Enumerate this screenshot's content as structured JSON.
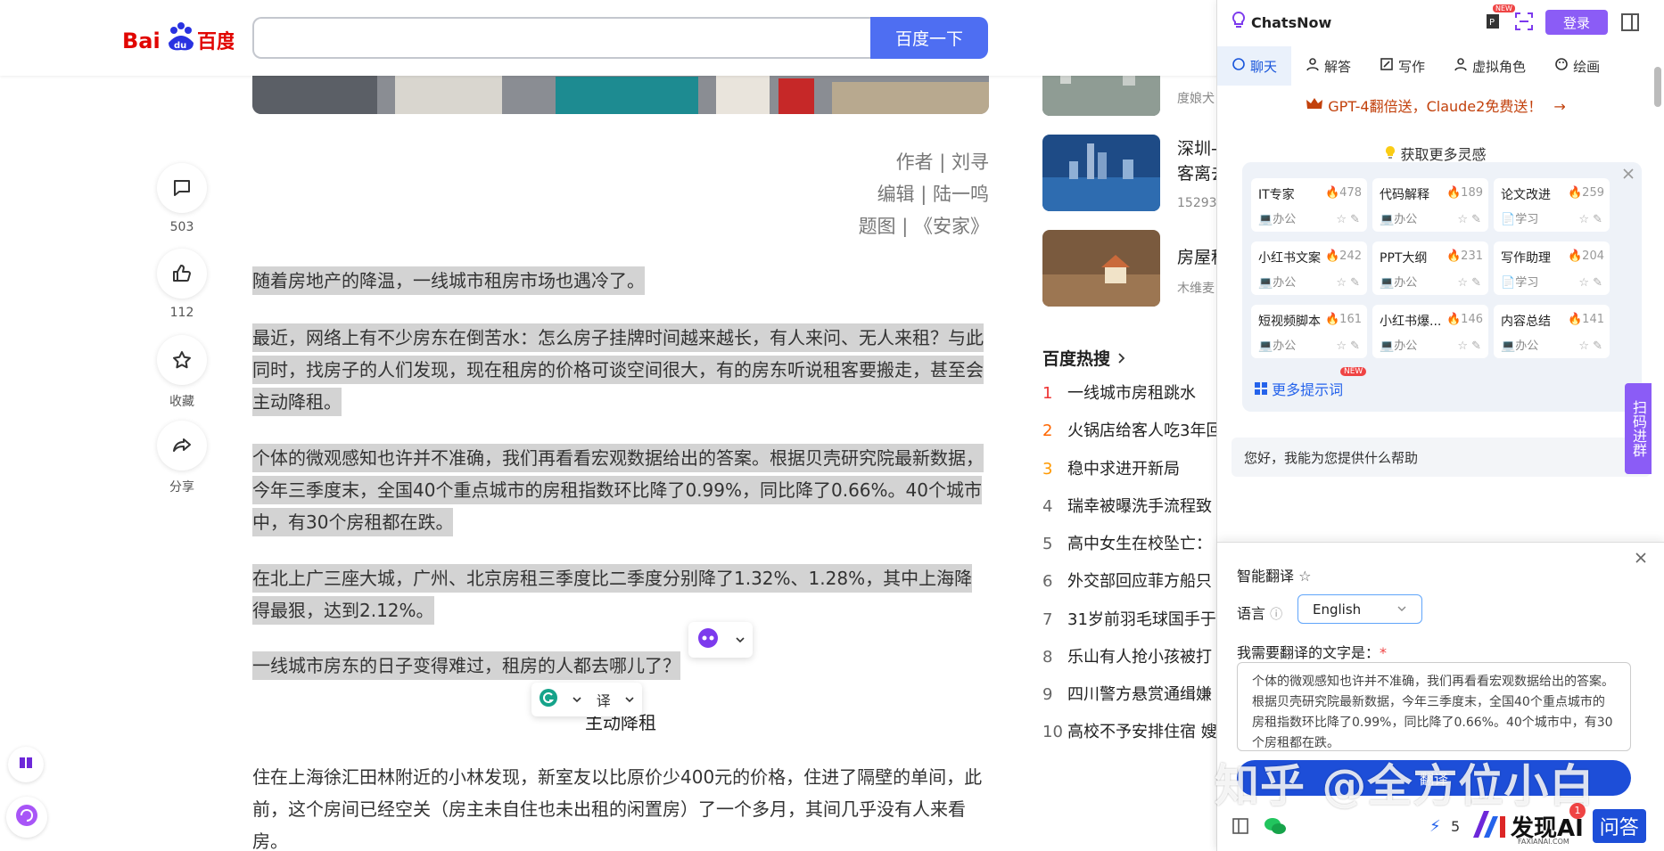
{
  "header": {
    "logo_text": "百度",
    "logo_prefix": "Bai",
    "logo_du": "du",
    "search_value": "",
    "search_button": "百度一下"
  },
  "actions": [
    {
      "name": "comment",
      "count": "503"
    },
    {
      "name": "like",
      "count": "112"
    },
    {
      "name": "collect",
      "count": "收藏"
    },
    {
      "name": "share",
      "count": "分享"
    }
  ],
  "article": {
    "credits": [
      "作者 | 刘寻",
      "编辑 | 陆一鸣",
      "题图 | 《安家》"
    ],
    "paragraphs": [
      "随着房地产的降温，一线城市租房市场也遇冷了。",
      "最近，网络上有不少房东在倒苦水：怎么房子挂牌时间越来越长，有人来问、无人来租？与此同时，找房子的人们发现，现在租房的价格可谈空间很大，有的房东听说租客要搬走，甚至会主动降租。",
      "个体的微观感知也许并不准确，我们再看看宏观数据给出的答案。根据贝壳研究院最新数据，今年三季度末，全国40个重点城市的房租指数环比降了0.99%，同比降了0.66%。40个城市中，有30个房租都在跌。",
      "在北上广三座大城，广州、北京房租三季度比二季度分别降了1.32%、1.28%，其中上海降得最狠，达到2.12%。",
      "一线城市房东的日子变得难过，租房的人都去哪儿了？"
    ],
    "subhead": "主动降租",
    "body": "住在上海徐汇田林附近的小林发现，新室友以比原价少400元的价格，住进了隔壁的单间，此前，这个房间已经空关（房主未自住也未出租的闲置房）了一个多月，其间几乎没有人来看房。"
  },
  "floating": {
    "translate_label": "译"
  },
  "news": [
    {
      "title": "",
      "meta": "度娘犬"
    },
    {
      "title": "深圳-客离去",
      "line2": "客离去",
      "meta": "15293"
    },
    {
      "title": "房屋租",
      "meta": "木维麦"
    }
  ],
  "hot": {
    "title": "百度热搜",
    "items": [
      {
        "rank": "1",
        "text": "一线城市房租跳水"
      },
      {
        "rank": "2",
        "text": "火锅店给客人吃3年回"
      },
      {
        "rank": "3",
        "text": "稳中求进开新局"
      },
      {
        "rank": "4",
        "text": "瑞幸被曝洗手流程致"
      },
      {
        "rank": "5",
        "text": "高中女生在校坠亡："
      },
      {
        "rank": "6",
        "text": "外交部回应菲方船只"
      },
      {
        "rank": "7",
        "text": "31岁前羽毛球国手于"
      },
      {
        "rank": "8",
        "text": "乐山有人抢小孩被打"
      },
      {
        "rank": "9",
        "text": "四川警方悬赏通缉嫌"
      },
      {
        "rank": "10",
        "text": "高校不予安排住宿 嫂"
      }
    ]
  },
  "chatsnow": {
    "brand": "ChatsNow",
    "new_tag": "NEW",
    "login": "登录",
    "tabs": [
      "聊天",
      "解答",
      "写作",
      "虚拟角色",
      "绘画"
    ],
    "promo": "GPT-4翻倍送，Claude2免费送！",
    "inspire": "获取更多灵感",
    "cards": [
      {
        "name": "IT专家",
        "hot": "478",
        "cat": "办公"
      },
      {
        "name": "代码解释",
        "hot": "189",
        "cat": "办公"
      },
      {
        "name": "论文改进",
        "hot": "259",
        "cat": "学习"
      },
      {
        "name": "小红书文案",
        "hot": "242",
        "cat": "办公"
      },
      {
        "name": "PPT大纲",
        "hot": "231",
        "cat": "办公"
      },
      {
        "name": "写作助理",
        "hot": "204",
        "cat": "学习"
      },
      {
        "name": "短视频脚本",
        "hot": "161",
        "cat": "办公"
      },
      {
        "name": "小红书爆...",
        "hot": "146",
        "cat": "办公"
      },
      {
        "name": "内容总结",
        "hot": "141",
        "cat": "办公"
      }
    ],
    "more_tips": "更多提示词",
    "more_tips_badge": "NEW",
    "greeting": "您好，我能为您提供什么帮助",
    "scan_group": "扫码进群"
  },
  "translate": {
    "title": "智能翻译",
    "lang_label": "语言",
    "lang_value": "English",
    "need_label": "我需要翻译的文字是：",
    "required_mark": "*",
    "text": "个体的微观感知也许并不准确，我们再看看宏观数据给出的答案。根据贝壳研究院最新数据，今年三季度末，全国40个重点城市的房租指数环比降了0.99%，同比降了0.66%。40个城市中，有30个房租都在跌。",
    "button": "翻译"
  },
  "watermark": "知乎 @全方位小白",
  "footer": {
    "credits_count": "5",
    "notify": "1",
    "faxian": "发现AI",
    "faxian_sub": "FAXIANAI.COM",
    "wenda": "问答"
  },
  "colors": {
    "baidu_blue": "#4e6ef2",
    "chatsnow_purple": "#8b5cf6",
    "highlight": "#d3d3d3"
  }
}
